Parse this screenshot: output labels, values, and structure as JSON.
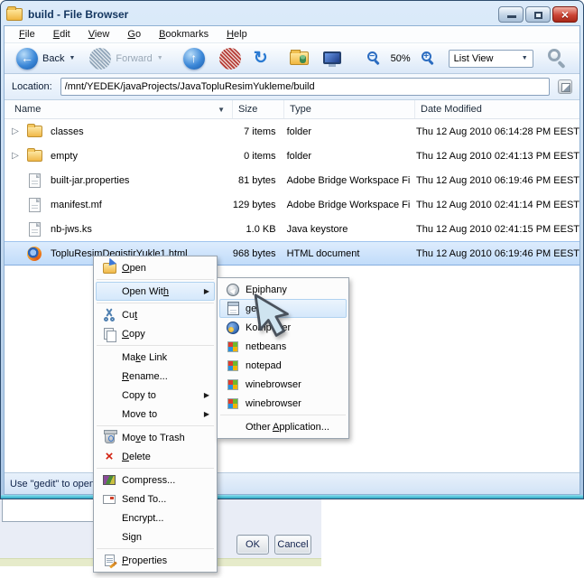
{
  "window": {
    "title": "build - File Browser",
    "status_text": "Use \"gedit\" to open"
  },
  "colors": {
    "selection_top": "#ddecfd",
    "selection_bottom": "#c1dcfa",
    "menu_highlight": "#e3f0fc",
    "title_text": "#13355f",
    "close_button": "#cc4434",
    "window_bottom_accent": "#2ca8c6"
  },
  "menubar": {
    "items": [
      {
        "label": "File",
        "accel": 0
      },
      {
        "label": "Edit",
        "accel": 0
      },
      {
        "label": "View",
        "accel": 0
      },
      {
        "label": "Go",
        "accel": 0
      },
      {
        "label": "Bookmarks",
        "accel": 0
      },
      {
        "label": "Help",
        "accel": 0
      }
    ]
  },
  "toolbar": {
    "back_label": "Back",
    "forward_label": "Forward",
    "zoom_level": "50%",
    "view_mode": "List View"
  },
  "location": {
    "label": "Location:",
    "value": "/mnt/YEDEK/javaProjects/JavaTopluResimYukleme/build"
  },
  "columns": {
    "name": "Name",
    "size": "Size",
    "type": "Type",
    "date": "Date Modified"
  },
  "files": [
    {
      "name": "classes",
      "size": "7 items",
      "type": "folder",
      "modified": "Thu 12 Aug 2010 06:14:28 PM EEST"
    },
    {
      "name": "empty",
      "size": "0 items",
      "type": "folder",
      "modified": "Thu 12 Aug 2010 02:41:13 PM EEST"
    },
    {
      "name": "built-jar.properties",
      "size": "81 bytes",
      "type": "Adobe Bridge Workspace File",
      "modified": "Thu 12 Aug 2010 06:19:46 PM EEST"
    },
    {
      "name": "manifest.mf",
      "size": "129 bytes",
      "type": "Adobe Bridge Workspace File",
      "modified": "Thu 12 Aug 2010 02:41:14 PM EEST"
    },
    {
      "name": "nb-jws.ks",
      "size": "1.0 KB",
      "type": "Java keystore",
      "modified": "Thu 12 Aug 2010 02:41:15 PM EEST"
    },
    {
      "name": "TopluResimDegistirYukle1.html",
      "size": "968 bytes",
      "type": "HTML document",
      "modified": "Thu 12 Aug 2010 06:19:46 PM EEST"
    }
  ],
  "context_menu": {
    "items": [
      {
        "label": "Open",
        "accel": 0
      },
      {
        "label": "Open With",
        "accel": 8
      },
      {
        "label": "Cut",
        "accel": 2
      },
      {
        "label": "Copy",
        "accel": 0
      },
      {
        "label": "Make Link",
        "accel": 2
      },
      {
        "label": "Rename...",
        "accel": 0
      },
      {
        "label": "Copy to",
        "accel": null
      },
      {
        "label": "Move to",
        "accel": null
      },
      {
        "label": "Move to Trash",
        "accel": 2
      },
      {
        "label": "Delete",
        "accel": 0
      },
      {
        "label": "Compress...",
        "accel": null
      },
      {
        "label": "Send To...",
        "accel": null
      },
      {
        "label": "Encrypt...",
        "accel": null
      },
      {
        "label": "Sign",
        "accel": null
      },
      {
        "label": "Properties",
        "accel": 0
      }
    ]
  },
  "open_with_submenu": {
    "items": [
      {
        "label": "Epiphany",
        "accel": null
      },
      {
        "label": "gedit",
        "accel": null
      },
      {
        "label": "Kompozer",
        "accel": null
      },
      {
        "label": "netbeans",
        "accel": null
      },
      {
        "label": "notepad",
        "accel": null
      },
      {
        "label": "winebrowser",
        "accel": null
      },
      {
        "label": "winebrowser",
        "accel": null
      },
      {
        "label": "Other Application...",
        "accel": 6
      }
    ]
  },
  "background_dialog": {
    "ok_label": "OK",
    "cancel_label": "Cancel"
  }
}
